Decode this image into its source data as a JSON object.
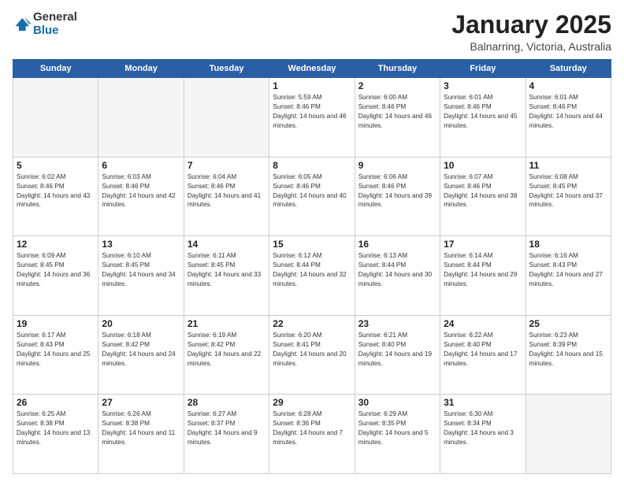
{
  "logo": {
    "general": "General",
    "blue": "Blue"
  },
  "title": {
    "month": "January 2025",
    "location": "Balnarring, Victoria, Australia"
  },
  "weekdays": [
    "Sunday",
    "Monday",
    "Tuesday",
    "Wednesday",
    "Thursday",
    "Friday",
    "Saturday"
  ],
  "weeks": [
    [
      {
        "day": "",
        "sunrise": "",
        "sunset": "",
        "daylight": ""
      },
      {
        "day": "",
        "sunrise": "",
        "sunset": "",
        "daylight": ""
      },
      {
        "day": "",
        "sunrise": "",
        "sunset": "",
        "daylight": ""
      },
      {
        "day": "1",
        "sunrise": "Sunrise: 5:59 AM",
        "sunset": "Sunset: 8:46 PM",
        "daylight": "Daylight: 14 hours and 46 minutes."
      },
      {
        "day": "2",
        "sunrise": "Sunrise: 6:00 AM",
        "sunset": "Sunset: 8:46 PM",
        "daylight": "Daylight: 14 hours and 46 minutes."
      },
      {
        "day": "3",
        "sunrise": "Sunrise: 6:01 AM",
        "sunset": "Sunset: 8:46 PM",
        "daylight": "Daylight: 14 hours and 45 minutes."
      },
      {
        "day": "4",
        "sunrise": "Sunrise: 6:01 AM",
        "sunset": "Sunset: 8:46 PM",
        "daylight": "Daylight: 14 hours and 44 minutes."
      }
    ],
    [
      {
        "day": "5",
        "sunrise": "Sunrise: 6:02 AM",
        "sunset": "Sunset: 8:46 PM",
        "daylight": "Daylight: 14 hours and 43 minutes."
      },
      {
        "day": "6",
        "sunrise": "Sunrise: 6:03 AM",
        "sunset": "Sunset: 8:46 PM",
        "daylight": "Daylight: 14 hours and 42 minutes."
      },
      {
        "day": "7",
        "sunrise": "Sunrise: 6:04 AM",
        "sunset": "Sunset: 8:46 PM",
        "daylight": "Daylight: 14 hours and 41 minutes."
      },
      {
        "day": "8",
        "sunrise": "Sunrise: 6:05 AM",
        "sunset": "Sunset: 8:46 PM",
        "daylight": "Daylight: 14 hours and 40 minutes."
      },
      {
        "day": "9",
        "sunrise": "Sunrise: 6:06 AM",
        "sunset": "Sunset: 8:46 PM",
        "daylight": "Daylight: 14 hours and 39 minutes."
      },
      {
        "day": "10",
        "sunrise": "Sunrise: 6:07 AM",
        "sunset": "Sunset: 8:46 PM",
        "daylight": "Daylight: 14 hours and 38 minutes."
      },
      {
        "day": "11",
        "sunrise": "Sunrise: 6:08 AM",
        "sunset": "Sunset: 8:45 PM",
        "daylight": "Daylight: 14 hours and 37 minutes."
      }
    ],
    [
      {
        "day": "12",
        "sunrise": "Sunrise: 6:09 AM",
        "sunset": "Sunset: 8:45 PM",
        "daylight": "Daylight: 14 hours and 36 minutes."
      },
      {
        "day": "13",
        "sunrise": "Sunrise: 6:10 AM",
        "sunset": "Sunset: 8:45 PM",
        "daylight": "Daylight: 14 hours and 34 minutes."
      },
      {
        "day": "14",
        "sunrise": "Sunrise: 6:11 AM",
        "sunset": "Sunset: 8:45 PM",
        "daylight": "Daylight: 14 hours and 33 minutes."
      },
      {
        "day": "15",
        "sunrise": "Sunrise: 6:12 AM",
        "sunset": "Sunset: 8:44 PM",
        "daylight": "Daylight: 14 hours and 32 minutes."
      },
      {
        "day": "16",
        "sunrise": "Sunrise: 6:13 AM",
        "sunset": "Sunset: 8:44 PM",
        "daylight": "Daylight: 14 hours and 30 minutes."
      },
      {
        "day": "17",
        "sunrise": "Sunrise: 6:14 AM",
        "sunset": "Sunset: 8:44 PM",
        "daylight": "Daylight: 14 hours and 29 minutes."
      },
      {
        "day": "18",
        "sunrise": "Sunrise: 6:16 AM",
        "sunset": "Sunset: 8:43 PM",
        "daylight": "Daylight: 14 hours and 27 minutes."
      }
    ],
    [
      {
        "day": "19",
        "sunrise": "Sunrise: 6:17 AM",
        "sunset": "Sunset: 8:43 PM",
        "daylight": "Daylight: 14 hours and 25 minutes."
      },
      {
        "day": "20",
        "sunrise": "Sunrise: 6:18 AM",
        "sunset": "Sunset: 8:42 PM",
        "daylight": "Daylight: 14 hours and 24 minutes."
      },
      {
        "day": "21",
        "sunrise": "Sunrise: 6:19 AM",
        "sunset": "Sunset: 8:42 PM",
        "daylight": "Daylight: 14 hours and 22 minutes."
      },
      {
        "day": "22",
        "sunrise": "Sunrise: 6:20 AM",
        "sunset": "Sunset: 8:41 PM",
        "daylight": "Daylight: 14 hours and 20 minutes."
      },
      {
        "day": "23",
        "sunrise": "Sunrise: 6:21 AM",
        "sunset": "Sunset: 8:40 PM",
        "daylight": "Daylight: 14 hours and 19 minutes."
      },
      {
        "day": "24",
        "sunrise": "Sunrise: 6:22 AM",
        "sunset": "Sunset: 8:40 PM",
        "daylight": "Daylight: 14 hours and 17 minutes."
      },
      {
        "day": "25",
        "sunrise": "Sunrise: 6:23 AM",
        "sunset": "Sunset: 8:39 PM",
        "daylight": "Daylight: 14 hours and 15 minutes."
      }
    ],
    [
      {
        "day": "26",
        "sunrise": "Sunrise: 6:25 AM",
        "sunset": "Sunset: 8:38 PM",
        "daylight": "Daylight: 14 hours and 13 minutes."
      },
      {
        "day": "27",
        "sunrise": "Sunrise: 6:26 AM",
        "sunset": "Sunset: 8:38 PM",
        "daylight": "Daylight: 14 hours and 11 minutes."
      },
      {
        "day": "28",
        "sunrise": "Sunrise: 6:27 AM",
        "sunset": "Sunset: 8:37 PM",
        "daylight": "Daylight: 14 hours and 9 minutes."
      },
      {
        "day": "29",
        "sunrise": "Sunrise: 6:28 AM",
        "sunset": "Sunset: 8:36 PM",
        "daylight": "Daylight: 14 hours and 7 minutes."
      },
      {
        "day": "30",
        "sunrise": "Sunrise: 6:29 AM",
        "sunset": "Sunset: 8:35 PM",
        "daylight": "Daylight: 14 hours and 5 minutes."
      },
      {
        "day": "31",
        "sunrise": "Sunrise: 6:30 AM",
        "sunset": "Sunset: 8:34 PM",
        "daylight": "Daylight: 14 hours and 3 minutes."
      },
      {
        "day": "",
        "sunrise": "",
        "sunset": "",
        "daylight": ""
      }
    ]
  ]
}
